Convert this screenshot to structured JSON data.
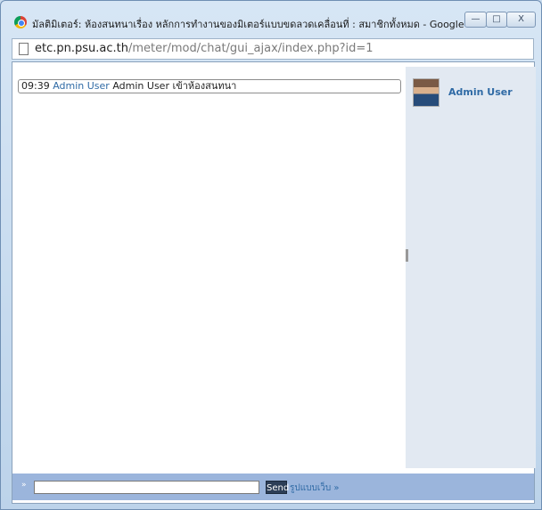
{
  "window": {
    "title": "มัลติมิเตอร์: ห้องสนทนาเรื่อง หลักการทำงานของมิเตอร์แบบขดลวดเคลื่อนที่ : สมาชิกทั้งหมด - Google C...",
    "minimize_label": "—",
    "maximize_label": "□",
    "close_label": "X"
  },
  "address_bar": {
    "domain": "etc.pn.psu.ac.th",
    "path": "/meter/mod/chat/gui_ajax/index.php?id=1"
  },
  "chat": {
    "messages": [
      {
        "time": "09:39",
        "user": "Admin User",
        "text": "Admin User เข้าห้องสนทนา"
      }
    ]
  },
  "users": [
    {
      "name": "Admin User"
    }
  ],
  "composer": {
    "prompt": "»",
    "input_value": "",
    "send_label": "Send",
    "theme_link": "รูปแบบเว็บ »"
  }
}
